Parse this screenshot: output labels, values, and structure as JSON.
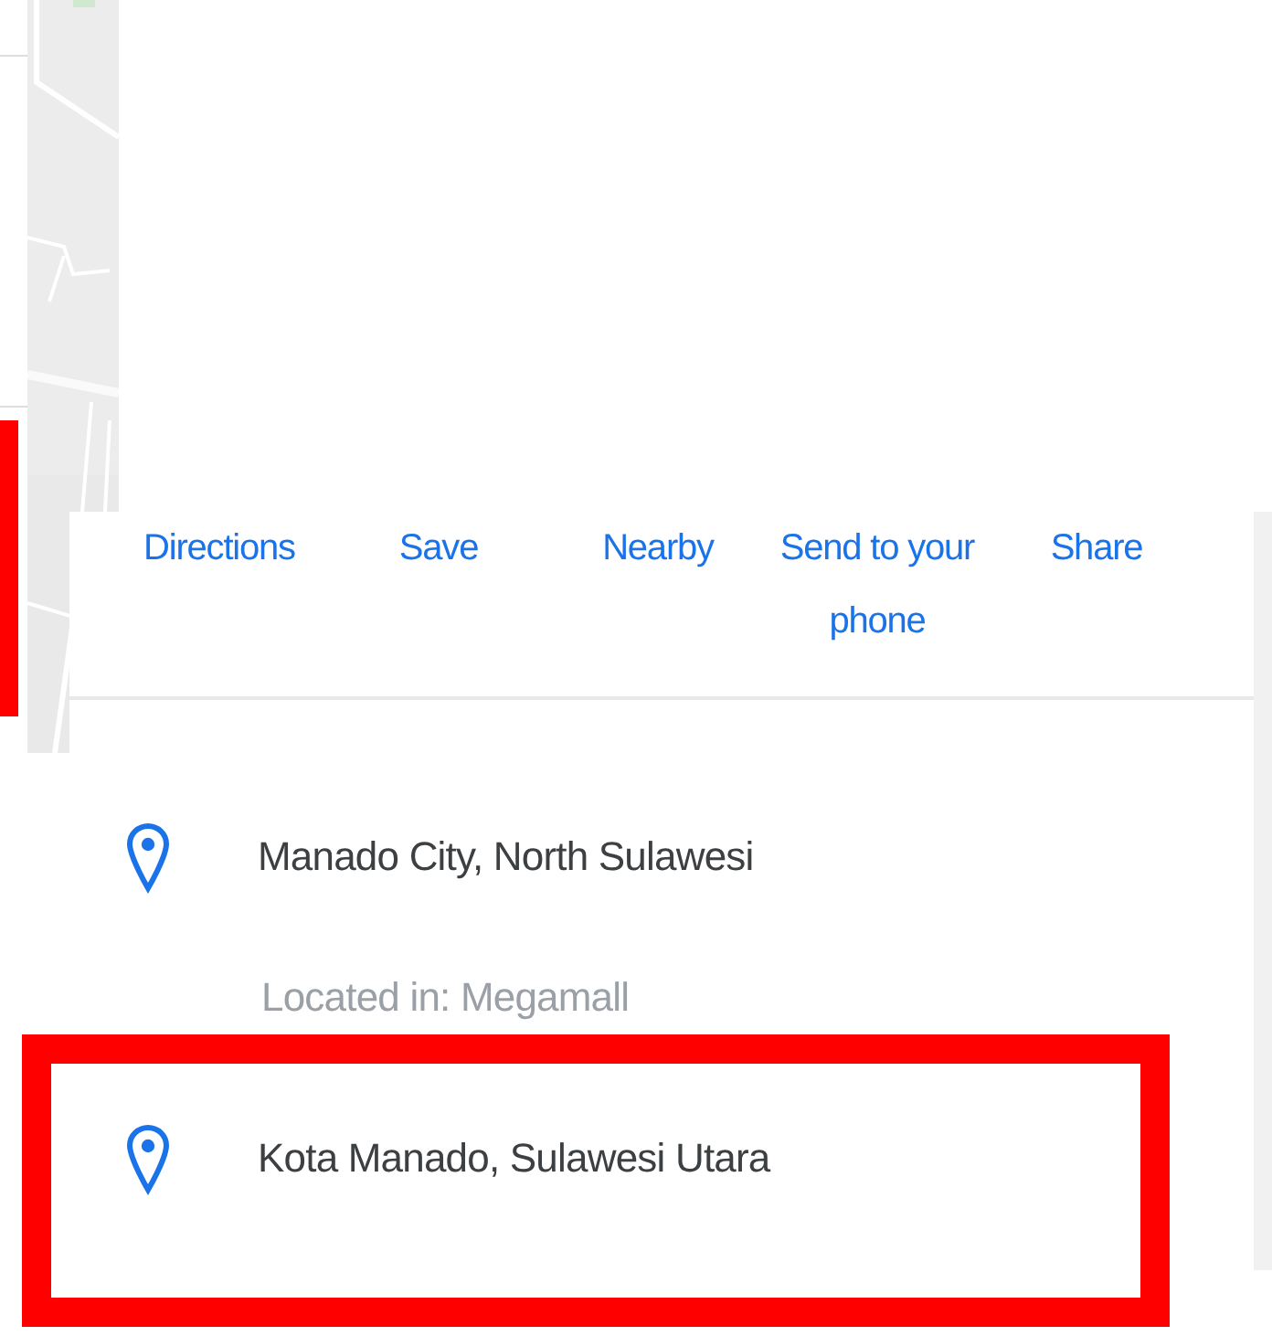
{
  "actions": [
    {
      "label": "Directions"
    },
    {
      "label": "Save"
    },
    {
      "label": "Nearby"
    },
    {
      "label": "Send to your phone"
    },
    {
      "label": "Share"
    }
  ],
  "results": [
    {
      "name": "Manado City, North Sulawesi",
      "located_in": "Located in: Megamall",
      "highlighted": false
    },
    {
      "name": "Kota Manado, Sulawesi Utara",
      "highlighted": true
    }
  ],
  "edge_highlight": true
}
